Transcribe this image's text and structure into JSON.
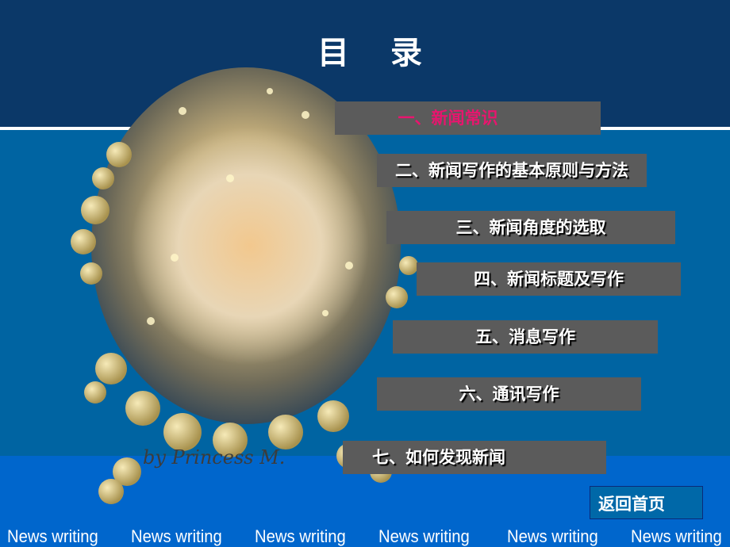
{
  "title": "目录",
  "menu": [
    {
      "label": "一、新闻常识",
      "active": true
    },
    {
      "label": "二、新闻写作的基本原则与方法"
    },
    {
      "label": "三、新闻角度的选取"
    },
    {
      "label": "四、新闻标题及写作"
    },
    {
      "label": "五、消息写作"
    },
    {
      "label": "六、通讯写作"
    },
    {
      "label": "七、如何发现新闻"
    }
  ],
  "back_button": "返回首页",
  "artwork_signature": "by Princess M.",
  "footer": [
    "News writing",
    "News writing",
    "News writing",
    "News writing",
    "News writing",
    "News writing"
  ],
  "colors": {
    "top_band": "#0b3868",
    "mid_band": "#0064a2",
    "bottom_band": "#0066cc",
    "button": "#5b5b5b",
    "active_text": "#e8156e"
  }
}
